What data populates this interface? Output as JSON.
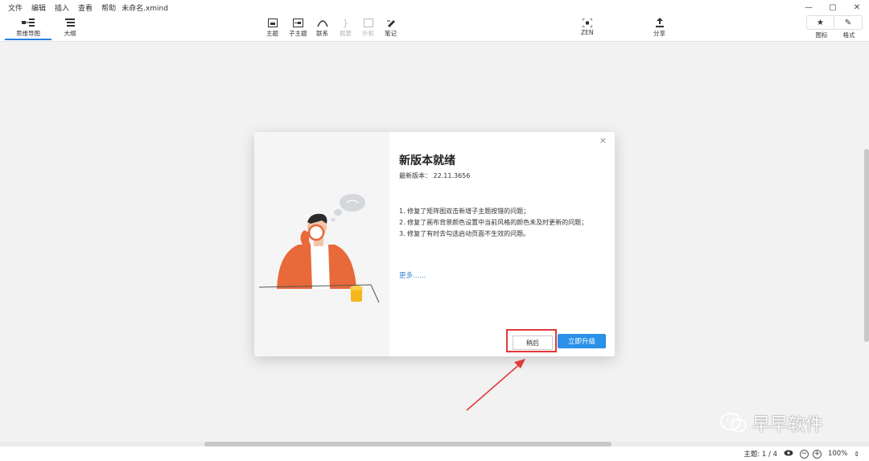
{
  "menu": [
    "文件",
    "编辑",
    "插入",
    "查看",
    "帮助"
  ],
  "doc_title": "未命名.xmind",
  "window_controls": {
    "minimize": "—",
    "maximize": "▢",
    "close": "✕"
  },
  "view_tabs": [
    {
      "label": "思维导图",
      "icon": "mindmap-icon",
      "active": true
    },
    {
      "label": "大纲",
      "icon": "outline-icon",
      "active": false
    }
  ],
  "toolbar": {
    "topic": "主题",
    "subtopic": "子主题",
    "relationship": "联系",
    "summary": "概要",
    "boundary": "外框",
    "note": "笔记",
    "zen": "ZEN",
    "share": "分享",
    "icons": "图标",
    "format": "格式"
  },
  "dialog": {
    "title": "新版本就绪",
    "version_label": "最新版本：",
    "version": "22.11.3656",
    "notes": [
      "1. 修复了矩阵图双击新增子主题按错的问题；",
      "2. 修复了画布背景颜色设置中当前风格的颜色未及时更新的问题；",
      "3. 修复了有时去勾选启动页面不生效的问题。"
    ],
    "more": "更多......",
    "later_button": "稍后",
    "upgrade_button": "立即升级",
    "close": "×"
  },
  "status": {
    "topic_count": "主题: 1 / 4",
    "zoom_out": "−",
    "zoom_in": "+",
    "zoom": "100%"
  },
  "watermark": "早早软件",
  "colors": {
    "accent": "#2a90e8",
    "highlight": "#e03a3a",
    "link": "#3b82d6"
  }
}
